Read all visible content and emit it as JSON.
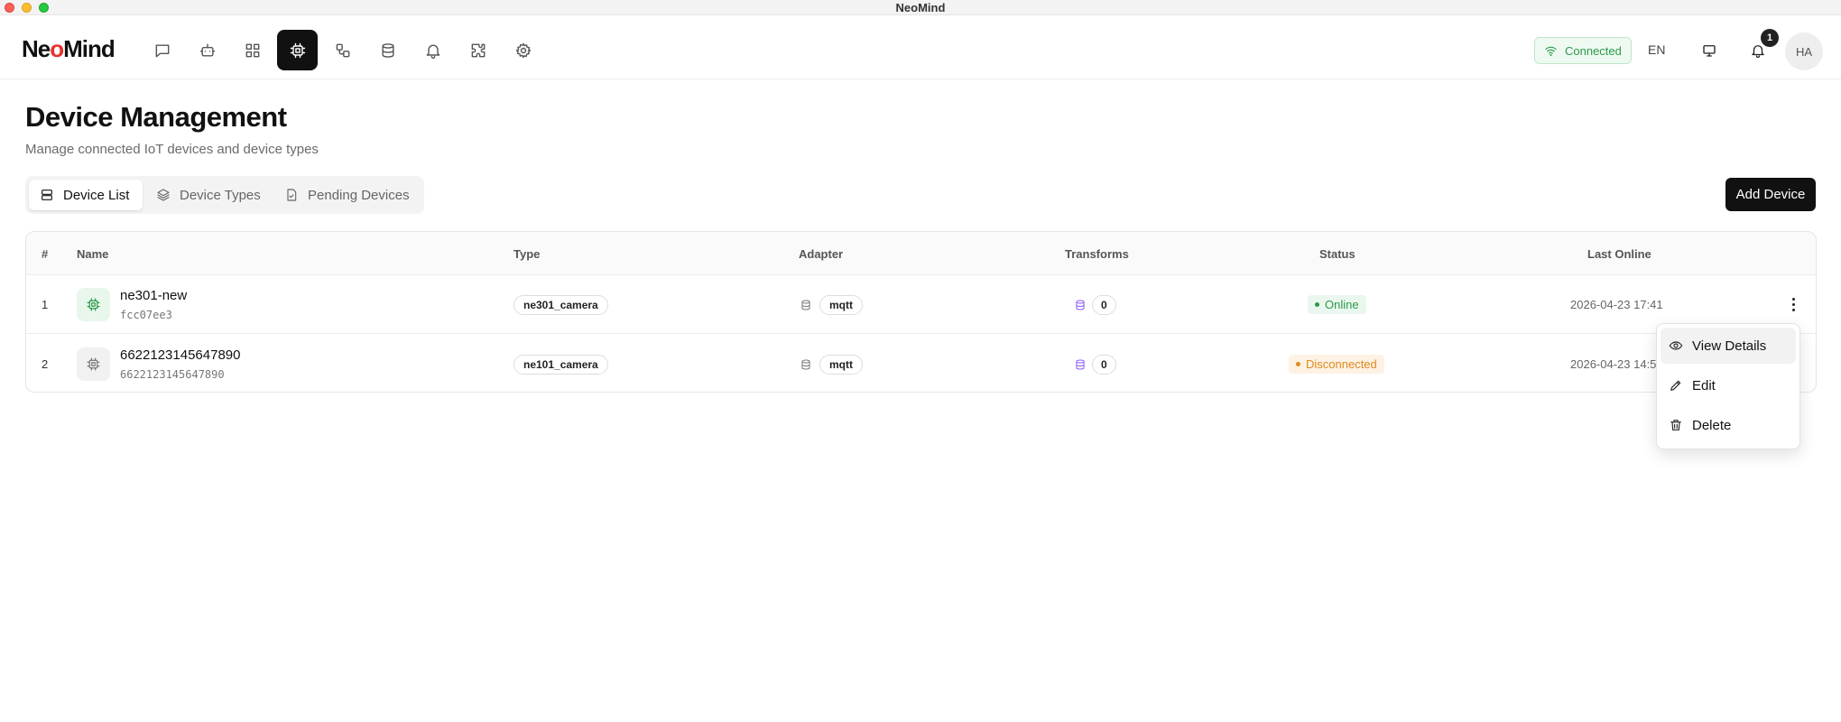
{
  "window": {
    "title": "NeoMind"
  },
  "brand": {
    "logo_pre": "Ne",
    "logo_mark": "o",
    "logo_post": "Mind"
  },
  "nav": {
    "items": [
      {
        "name": "chat",
        "icon": "chat-icon"
      },
      {
        "name": "agents",
        "icon": "bot-icon"
      },
      {
        "name": "dashboard",
        "icon": "grid-icon"
      },
      {
        "name": "devices",
        "icon": "cpu-icon",
        "active": true
      },
      {
        "name": "automation",
        "icon": "workflow-icon"
      },
      {
        "name": "data",
        "icon": "database-icon"
      },
      {
        "name": "alerts",
        "icon": "bell-icon"
      },
      {
        "name": "extensions",
        "icon": "puzzle-icon"
      },
      {
        "name": "settings",
        "icon": "gear-icon"
      }
    ]
  },
  "header": {
    "status_label": "Connected",
    "language": "EN",
    "notification_count": "1",
    "avatar_initials": "HA"
  },
  "page": {
    "title": "Device Management",
    "subtitle": "Manage connected IoT devices and device types",
    "add_button": "Add Device"
  },
  "tabs": [
    {
      "label": "Device List",
      "icon": "list-icon",
      "active": true
    },
    {
      "label": "Device Types",
      "icon": "layers-icon"
    },
    {
      "label": "Pending Devices",
      "icon": "file-check-icon"
    }
  ],
  "table": {
    "columns": {
      "index": "#",
      "name": "Name",
      "type": "Type",
      "adapter": "Adapter",
      "transforms": "Transforms",
      "status": "Status",
      "last_online": "Last Online"
    },
    "rows": [
      {
        "index": "1",
        "name": "ne301-new",
        "id": "fcc07ee3",
        "type": "ne301_camera",
        "adapter": "mqtt",
        "transforms": "0",
        "status": "Online",
        "last_online": "2026-04-23 17:41"
      },
      {
        "index": "2",
        "name": "6622123145647890",
        "id": "6622123145647890",
        "type": "ne101_camera",
        "adapter": "mqtt",
        "transforms": "0",
        "status": "Disconnected",
        "last_online": "2026-04-23 14:5"
      }
    ]
  },
  "row_menu": {
    "items": [
      {
        "label": "View Details",
        "icon": "eye-icon"
      },
      {
        "label": "Edit",
        "icon": "pencil-icon"
      },
      {
        "label": "Delete",
        "icon": "trash-icon"
      }
    ]
  },
  "colors": {
    "online": "#2c9a49",
    "disconnected": "#e08a1e",
    "primary": "#111111",
    "logo_accent": "#e5322d"
  }
}
